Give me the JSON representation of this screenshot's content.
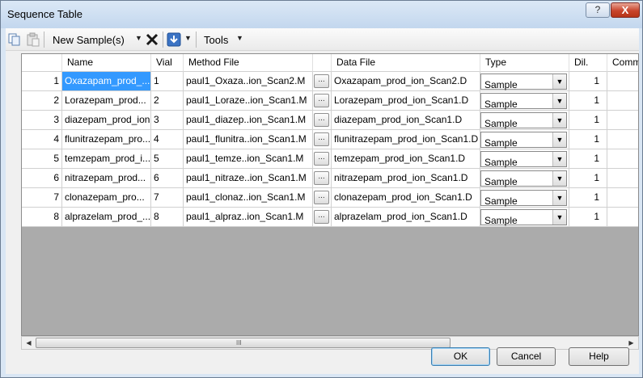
{
  "window": {
    "title": "Sequence Table",
    "help_glyph": "?",
    "close_glyph": "X"
  },
  "toolbar": {
    "new_samples_label": "New Sample(s)",
    "tools_label": "Tools",
    "copy_icon": "copy-icon",
    "paste_icon": "paste-icon",
    "delete_icon": "delete-x-icon",
    "insert_icon": "insert-down-icon"
  },
  "table": {
    "columns": [
      "Name",
      "Vial",
      "Method File",
      "",
      "Data File",
      "Type",
      "Dil.",
      "Comm"
    ],
    "rows": [
      {
        "num": "1",
        "name": "Oxazapam_prod_...",
        "vial": "1",
        "method": "paul1_Oxaza..ion_Scan2.M",
        "data": "Oxazapam_prod_ion_Scan2.D",
        "type": "Sample",
        "dil": "1"
      },
      {
        "num": "2",
        "name": "Lorazepam_prod...",
        "vial": "2",
        "method": "paul1_Loraze..ion_Scan1.M",
        "data": "Lorazepam_prod_ion_Scan1.D",
        "type": "Sample",
        "dil": "1"
      },
      {
        "num": "3",
        "name": "diazepam_prod_ion",
        "vial": "3",
        "method": "paul1_diazep..ion_Scan1.M",
        "data": "diazepam_prod_ion_Scan1.D",
        "type": "Sample",
        "dil": "1"
      },
      {
        "num": "4",
        "name": "flunitrazepam_pro...",
        "vial": "4",
        "method": "paul1_flunitra..ion_Scan1.M",
        "data": "flunitrazepam_prod_ion_Scan1.D",
        "type": "Sample",
        "dil": "1"
      },
      {
        "num": "5",
        "name": "temzepam_prod_i...",
        "vial": "5",
        "method": "paul1_temze..ion_Scan1.M",
        "data": "temzepam_prod_ion_Scan1.D",
        "type": "Sample",
        "dil": "1"
      },
      {
        "num": "6",
        "name": "nitrazepam_prod...",
        "vial": "6",
        "method": "paul1_nitraze..ion_Scan1.M",
        "data": "nitrazepam_prod_ion_Scan1.D",
        "type": "Sample",
        "dil": "1"
      },
      {
        "num": "7",
        "name": "clonazepam_pro...",
        "vial": "7",
        "method": "paul1_clonaz..ion_Scan1.M",
        "data": "clonazepam_prod_ion_Scan1.D",
        "type": "Sample",
        "dil": "1"
      },
      {
        "num": "8",
        "name": "alprazelam_prod_...",
        "vial": "8",
        "method": "paul1_alpraz..ion_Scan1.M",
        "data": "alprazelam_prod_ion_Scan1.D",
        "type": "Sample",
        "dil": "1"
      }
    ],
    "ellipsis_label": "..."
  },
  "scrollbar": {
    "grip": "III"
  },
  "buttons": {
    "ok": "OK",
    "cancel": "Cancel",
    "help": "Help"
  },
  "colors": {
    "selection": "#3399ff",
    "grid_empty": "#ababab",
    "close_button": "#c8442c"
  }
}
